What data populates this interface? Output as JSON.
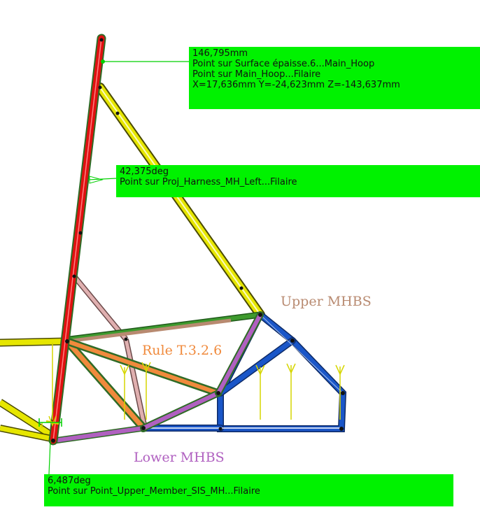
{
  "annotations": {
    "distance": {
      "value": "146,795mm",
      "line1": "Point sur Surface épaisse.6...Main_Hoop",
      "line2": "Point sur Main_Hoop...Filaire",
      "coords": "X=17,636mm  Y=-24,623mm  Z=-143,637mm"
    },
    "angle_upper": {
      "value": "42,375deg",
      "line1": "Point sur Proj_Harness_MH_Left...Filaire"
    },
    "angle_lower": {
      "value": "6,487deg",
      "line1": "Point sur Point_Upper_Member_SIS_MH...Filaire"
    }
  },
  "labels": {
    "upper_mhbs": "Upper MHBS",
    "rule": "Rule T.3.2.6",
    "lower_mhbs": "Lower MHBS"
  },
  "colors": {
    "annotation_bg": "#00f200",
    "main_hoop": "#e01010",
    "brace": "#e6e600",
    "blue_frame": "#1a56c8",
    "upper_mhbs": "#b88a70",
    "rule": "#f08a3c",
    "lower_mhbs": "#b060c0",
    "upper_member": "#3e9a2e"
  }
}
